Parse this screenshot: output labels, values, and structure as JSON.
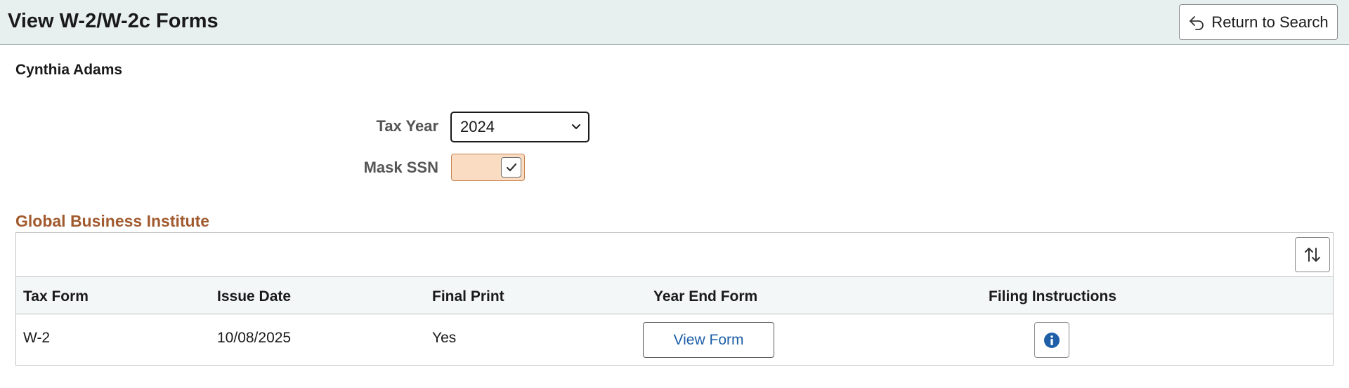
{
  "header": {
    "title": "View W-2/W-2c Forms",
    "return_label": "Return to Search"
  },
  "employee": {
    "name": "Cynthia Adams"
  },
  "filters": {
    "tax_year_label": "Tax Year",
    "tax_year_value": "2024",
    "mask_ssn_label": "Mask SSN",
    "mask_ssn_checked": true
  },
  "section": {
    "title": "Global Business Institute",
    "accent_color": "#a15a2e"
  },
  "table": {
    "columns": [
      "Tax Form",
      "Issue Date",
      "Final Print",
      "Year End Form",
      "Filing Instructions"
    ],
    "rows": [
      {
        "tax_form": "W-2",
        "issue_date": "10/08/2025",
        "final_print": "Yes",
        "year_end_form_label": "View Form",
        "filing_icon": "info-icon"
      }
    ]
  },
  "colors": {
    "header_bg": "#e8f0ef",
    "link_blue": "#1e5fa8",
    "toggle_on_bg": "#f9dcc1",
    "info_icon": "#1e5fa8"
  }
}
